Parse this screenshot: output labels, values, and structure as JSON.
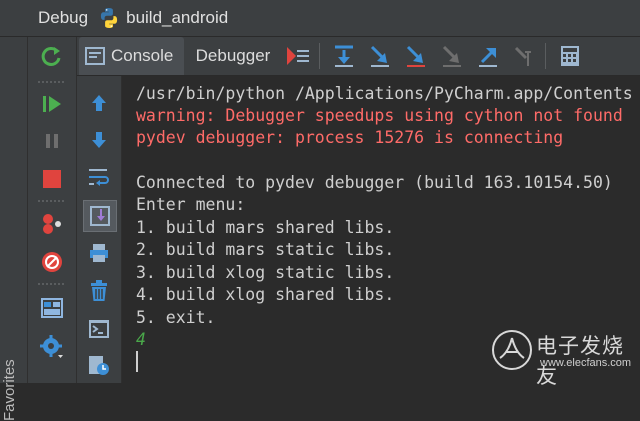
{
  "titlebar": {
    "label": "Debug",
    "config_name": "build_android"
  },
  "favorites": {
    "label": "Favorites"
  },
  "tabs": {
    "console": "Console",
    "debugger": "Debugger"
  },
  "left_toolbar": {
    "icons": [
      "rerun-icon",
      "resume-icon",
      "pause-icon",
      "stop-icon",
      "view-breakpoints-icon",
      "mute-breakpoints-icon",
      "layout-icon",
      "settings-icon"
    ]
  },
  "console": {
    "lines": [
      {
        "text": "/usr/bin/python /Applications/PyCharm.app/Contents",
        "kind": "normal"
      },
      {
        "text": "warning: Debugger speedups using cython not found",
        "kind": "err"
      },
      {
        "text": "pydev debugger: process 15276 is connecting",
        "kind": "err"
      },
      {
        "text": "",
        "kind": "normal"
      },
      {
        "text": "Connected to pydev debugger (build 163.10154.50)",
        "kind": "normal"
      },
      {
        "text": "Enter menu:",
        "kind": "normal"
      },
      {
        "text": "1. build mars shared libs.",
        "kind": "normal"
      },
      {
        "text": "2. build mars static libs.",
        "kind": "normal"
      },
      {
        "text": "3. build xlog static libs.",
        "kind": "normal"
      },
      {
        "text": "4. build xlog shared libs.",
        "kind": "normal"
      },
      {
        "text": "5. exit.",
        "kind": "normal"
      },
      {
        "text": "4",
        "kind": "input"
      }
    ]
  },
  "watermark": {
    "title": "电子发烧友",
    "url": "www.elecfans.com"
  },
  "colors": {
    "error": "#ff6b68",
    "input": "#4aa84a",
    "accent_blue": "#3d8fd6",
    "green": "#4caf50",
    "red": "#e0443e"
  }
}
